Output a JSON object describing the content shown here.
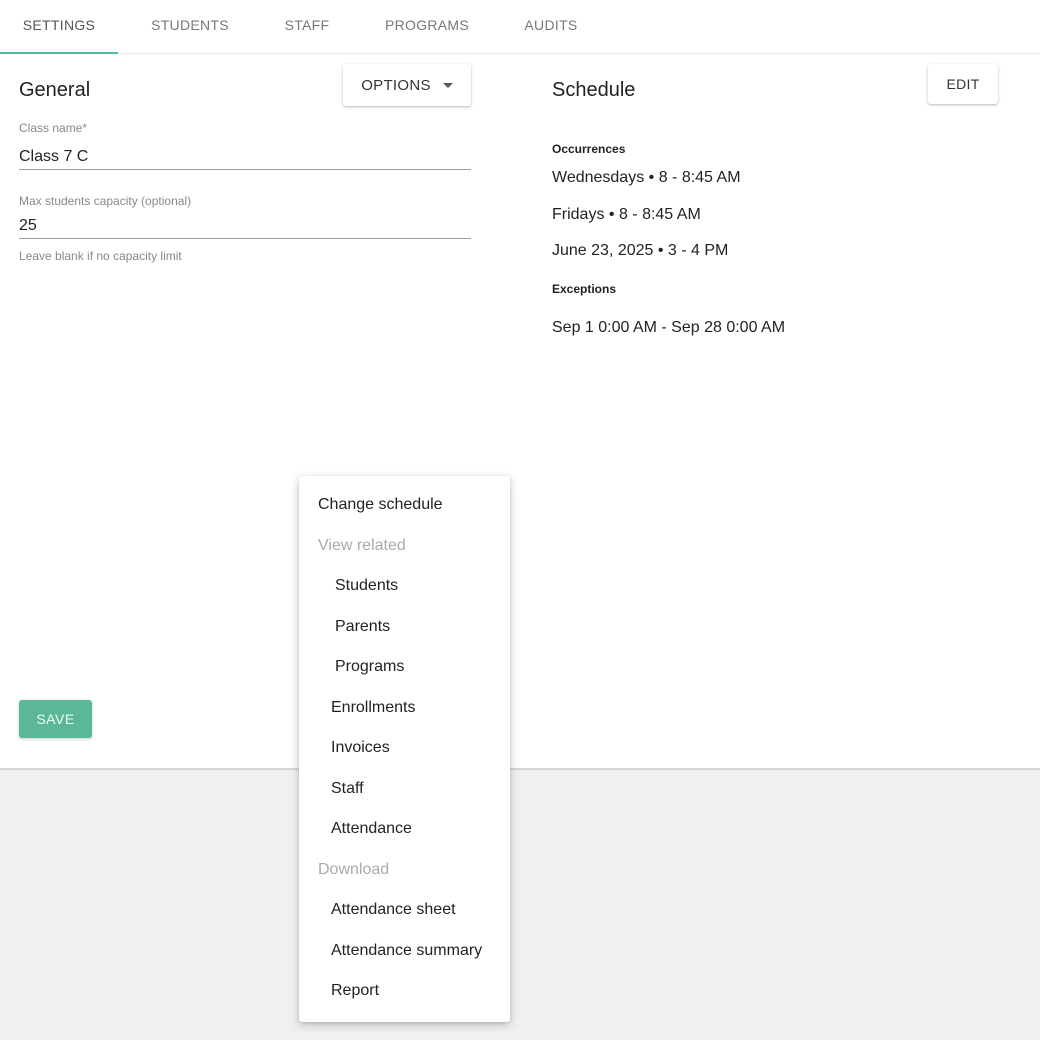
{
  "tabs": [
    {
      "label": "SETTINGS",
      "active": true
    },
    {
      "label": "STUDENTS"
    },
    {
      "label": "STAFF"
    },
    {
      "label": "PROGRAMS"
    },
    {
      "label": "AUDITS"
    }
  ],
  "general": {
    "title": "General",
    "options_label": "OPTIONS",
    "class_name_label": "Class name*",
    "class_name_value": "Class 7 C",
    "capacity_label": "Max students capacity (optional)",
    "capacity_value": "25",
    "capacity_help": "Leave blank if no capacity limit",
    "save_label": "SAVE"
  },
  "schedule": {
    "title": "Schedule",
    "edit_label": "EDIT",
    "occurrences_label": "Occurrences",
    "occurrences": [
      "Wednesdays •  8 - 8:45 AM",
      "Fridays •  8 - 8:45 AM",
      "June 23, 2025 • 3 - 4 PM"
    ],
    "exceptions_label": "Exceptions",
    "exceptions": [
      "Sep 1 0:00 AM - Sep 28 0:00 AM"
    ]
  },
  "options_menu": {
    "change_schedule": "Change schedule",
    "view_related_header": "View related",
    "view_related": [
      "Students",
      "Parents",
      "Programs"
    ],
    "items": [
      "Enrollments",
      "Invoices",
      "Staff",
      "Attendance"
    ],
    "download_header": "Download",
    "download": [
      "Attendance sheet",
      "Attendance summary",
      "Report"
    ]
  },
  "colors": {
    "accent": "#5bb795"
  }
}
